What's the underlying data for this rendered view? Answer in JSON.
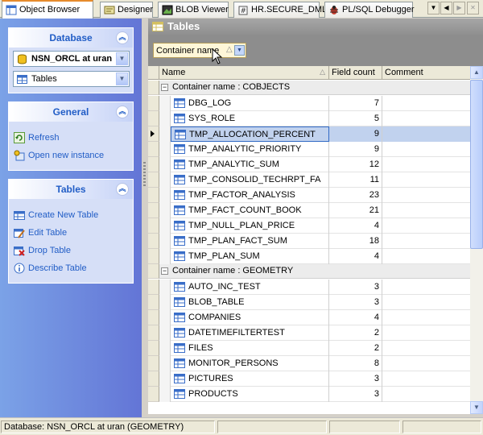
{
  "tabs": [
    {
      "label": "Object Browser",
      "active": true,
      "icon": "object-browser-icon"
    },
    {
      "label": "Designer",
      "active": false,
      "icon": "designer-icon"
    },
    {
      "label": "BLOB Viewer",
      "active": false,
      "icon": "blob-viewer-icon"
    },
    {
      "label": "HR.SECURE_DML",
      "active": false,
      "icon": "procedure-icon"
    },
    {
      "label": "PL/SQL Debugger",
      "active": false,
      "icon": "debugger-icon"
    }
  ],
  "tab_nav": {
    "down": "▼",
    "left": "◀",
    "right": "▶",
    "close": "✕"
  },
  "sidebar": {
    "database": {
      "title": "Database",
      "connection": "NSN_ORCL at uran",
      "object_type": "Tables"
    },
    "general": {
      "title": "General",
      "items": [
        {
          "label": "Refresh",
          "icon": "refresh-icon"
        },
        {
          "label": "Open new instance",
          "icon": "new-instance-icon"
        }
      ]
    },
    "tables": {
      "title": "Tables",
      "items": [
        {
          "label": "Create New Table",
          "icon": "create-table-icon"
        },
        {
          "label": "Edit Table",
          "icon": "edit-table-icon"
        },
        {
          "label": "Drop Table",
          "icon": "drop-table-icon"
        },
        {
          "label": "Describe Table",
          "icon": "info-icon"
        }
      ]
    }
  },
  "main": {
    "title": "Tables",
    "group_by_chip": "Container name",
    "columns": [
      "Name",
      "Field count",
      "Comment"
    ],
    "groups": [
      {
        "label": "Container name : COBJECTS",
        "rows": [
          {
            "name": "DBG_LOG",
            "count": "7"
          },
          {
            "name": "SYS_ROLE",
            "count": "5"
          },
          {
            "name": "TMP_ALLOCATION_PERCENT",
            "count": "9",
            "selected": true
          },
          {
            "name": "TMP_ANALYTIC_PRIORITY",
            "count": "9"
          },
          {
            "name": "TMP_ANALYTIC_SUM",
            "count": "12"
          },
          {
            "name": "TMP_CONSOLID_TECHRPT_FA",
            "count": "11"
          },
          {
            "name": "TMP_FACTOR_ANALYSIS",
            "count": "23"
          },
          {
            "name": "TMP_FACT_COUNT_BOOK",
            "count": "21"
          },
          {
            "name": "TMP_NULL_PLAN_PRICE",
            "count": "4"
          },
          {
            "name": "TMP_PLAN_FACT_SUM",
            "count": "18"
          },
          {
            "name": "TMP_PLAN_SUM",
            "count": "4"
          }
        ]
      },
      {
        "label": "Container name : GEOMETRY",
        "rows": [
          {
            "name": "AUTO_INC_TEST",
            "count": "3"
          },
          {
            "name": "BLOB_TABLE",
            "count": "3"
          },
          {
            "name": "COMPANIES",
            "count": "4"
          },
          {
            "name": "DATETIMEFILTERTEST",
            "count": "2"
          },
          {
            "name": "FILES",
            "count": "2"
          },
          {
            "name": "MONITOR_PERSONS",
            "count": "8"
          },
          {
            "name": "PICTURES",
            "count": "3"
          },
          {
            "name": "PRODUCTS",
            "count": "3"
          }
        ]
      }
    ]
  },
  "status": {
    "text": "Database: NSN_ORCL at uran (GEOMETRY)"
  },
  "colors": {
    "accent": "#215dc6",
    "selection": "#c1d2ee",
    "sidebar_gradient": [
      "#7ba2e7",
      "#6375d6"
    ]
  }
}
